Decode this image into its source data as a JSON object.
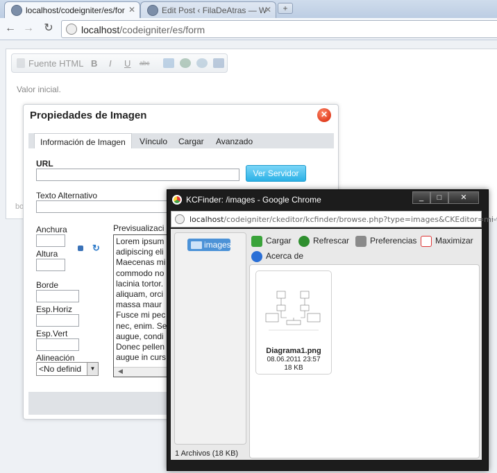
{
  "browser": {
    "tabs": [
      {
        "title": "localhost/codeigniter/es/for",
        "active": true
      },
      {
        "title": "Edit Post ‹ FilaDeAtras — W",
        "active": false
      }
    ],
    "address": {
      "host": "localhost",
      "path": "/codeigniter/es/form"
    }
  },
  "editor": {
    "toolbar": {
      "source_label": "Fuente HTML",
      "bold": "B",
      "italic": "I",
      "underline": "U",
      "strike": "abc"
    },
    "content": "Valor inicial.",
    "status": "bo"
  },
  "dialog": {
    "title": "Propiedades de Imagen",
    "tabs": [
      "Información de Imagen",
      "Vínculo",
      "Cargar",
      "Avanzado"
    ],
    "url_label": "URL",
    "browse_button": "Ver Servidor",
    "alt_label": "Texto Alternativo",
    "width_label": "Anchura",
    "height_label": "Altura",
    "border_label": "Borde",
    "hspace_label": "Esp.Horiz",
    "vspace_label": "Esp.Vert",
    "align_label": "Alineación",
    "align_value": "<No definid",
    "preview_label": "Previsualizaci",
    "preview_text": "Lorem ipsum\nadipiscing eli\nMaecenas mi\ncommodo no\nlacinia tortor.\naliquam, orci\nmassa maur\nFusce mi pec\nnec, enim. Se\naugue, condi\nDonec pellen\naugue in curs"
  },
  "kcfinder": {
    "window_title": "KCFinder: /images - Google Chrome",
    "url_host": "localhost",
    "url_rest": "/codeigniter/ckeditor/kcfinder/browse.php?type=images&CKEditor=mi-t",
    "folder": "images",
    "buttons": {
      "upload": "Cargar",
      "refresh": "Refrescar",
      "settings": "Preferencias",
      "maximize": "Maximizar",
      "about": "Acerca de"
    },
    "file": {
      "name": "Diagrama1.png",
      "date": "08.06.2011 23:57",
      "size": "18 KB"
    },
    "status": "1 Archivos (18 KB)"
  }
}
